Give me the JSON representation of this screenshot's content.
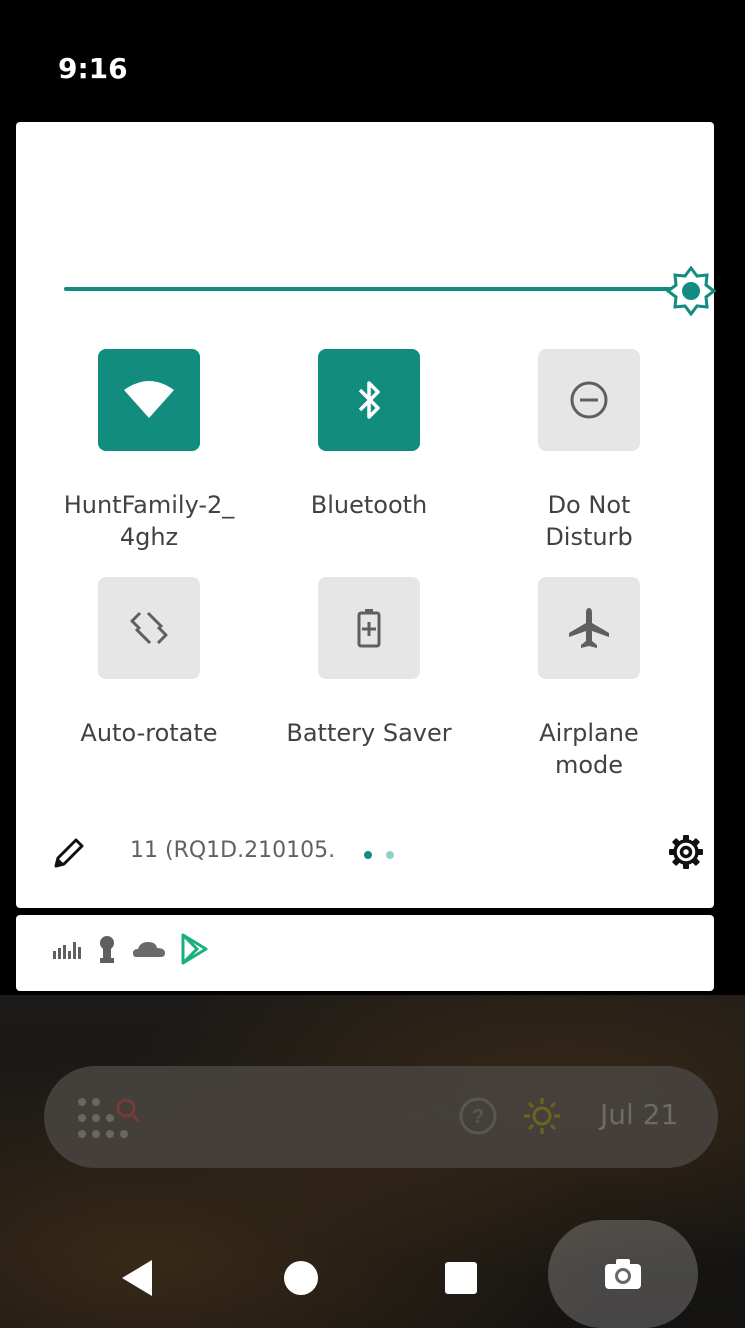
{
  "status_bar": {
    "time": "9:16"
  },
  "quick_settings": {
    "tiles": [
      {
        "label": "HuntFamily-2_\n4ghz",
        "icon": "wifi-icon",
        "state": "on"
      },
      {
        "label": "Bluetooth",
        "icon": "bluetooth-icon",
        "state": "on"
      },
      {
        "label": "Do Not\nDisturb",
        "icon": "do-not-disturb-icon",
        "state": "off"
      },
      {
        "label": "Auto-rotate",
        "icon": "auto-rotate-icon",
        "state": "off"
      },
      {
        "label": "Battery Saver",
        "icon": "battery-saver-icon",
        "state": "off"
      },
      {
        "label": "Airplane\nmode",
        "icon": "airplane-icon",
        "state": "off"
      }
    ],
    "build_number": "11 (RQ1D.210105.",
    "brightness_level": 1.0
  },
  "notifications": {
    "icons": [
      "signal-bars-icon",
      "keyhole-icon",
      "cloud-icon",
      "play-store-icon"
    ]
  },
  "home": {
    "date": "Jul 21"
  },
  "colors": {
    "accent": "#128c7e",
    "tile_off": "#e6e6e6"
  }
}
